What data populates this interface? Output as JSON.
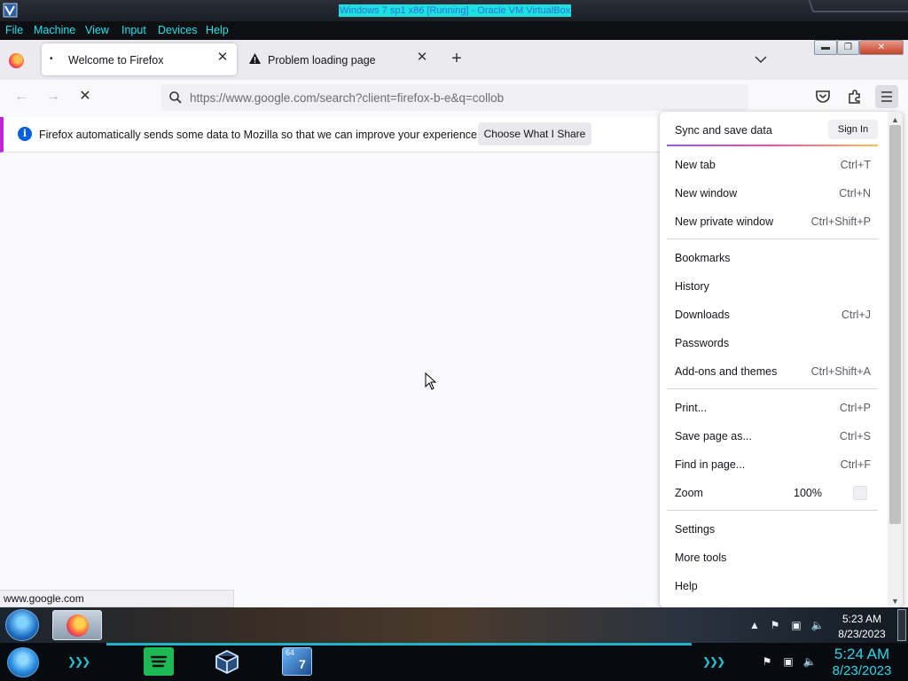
{
  "vm": {
    "title": "Windows 7 sp1 x86 [Running] - Oracle VM VirtualBox",
    "menu": [
      "File",
      "Machine",
      "View",
      "Input",
      "Devices",
      "Help"
    ]
  },
  "browser": {
    "tabs": [
      {
        "label": "Welcome to Firefox",
        "state": "loading"
      },
      {
        "label": "Problem loading page",
        "state": "error"
      }
    ],
    "url": "https://www.google.com/search?client=firefox-b-e&q=collob",
    "notification": {
      "message": "Firefox automatically sends some data to Mozilla so that we can improve your experience.",
      "button": "Choose What I Share"
    },
    "status_url": "www.google.com",
    "app_menu": {
      "sync_label": "Sync and save data",
      "sign_in": "Sign In",
      "group1": [
        {
          "label": "New tab",
          "shortcut": "Ctrl+T"
        },
        {
          "label": "New window",
          "shortcut": "Ctrl+N"
        },
        {
          "label": "New private window",
          "shortcut": "Ctrl+Shift+P"
        }
      ],
      "group2": [
        {
          "label": "Bookmarks",
          "shortcut": ""
        },
        {
          "label": "History",
          "shortcut": ""
        },
        {
          "label": "Downloads",
          "shortcut": "Ctrl+J"
        },
        {
          "label": "Passwords",
          "shortcut": ""
        },
        {
          "label": "Add-ons and themes",
          "shortcut": "Ctrl+Shift+A"
        }
      ],
      "group3": [
        {
          "label": "Print...",
          "shortcut": "Ctrl+P"
        },
        {
          "label": "Save page as...",
          "shortcut": "Ctrl+S"
        },
        {
          "label": "Find in page...",
          "shortcut": "Ctrl+F"
        }
      ],
      "zoom": {
        "label": "Zoom",
        "value": "100%"
      },
      "group4": [
        {
          "label": "Settings",
          "shortcut": ""
        },
        {
          "label": "More tools",
          "shortcut": ""
        },
        {
          "label": "Help",
          "shortcut": ""
        }
      ]
    }
  },
  "guest_taskbar": {
    "time": "5:23 AM",
    "date": "8/23/2023"
  },
  "host_taskbar": {
    "time": "5:24 AM",
    "date": "8/23/2023",
    "badge": "64",
    "badge_num": "7"
  },
  "colors": {
    "vm_menu_text": "#22e3f0",
    "accent": "#0060df",
    "host_clock": "#2ad6e6"
  }
}
